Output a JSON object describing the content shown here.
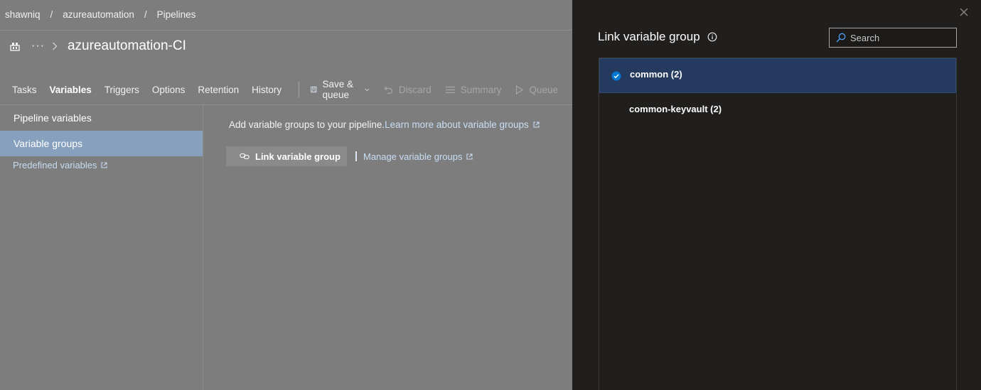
{
  "breadcrumb": [
    "shawniq",
    "azureautomation",
    "Pipelines"
  ],
  "breadcrumb_separator": "/",
  "pipeline": {
    "more_label": "···",
    "title": "azureautomation-CI"
  },
  "tabs": [
    {
      "label": "Tasks",
      "active": false
    },
    {
      "label": "Variables",
      "active": true
    },
    {
      "label": "Triggers",
      "active": false
    },
    {
      "label": "Options",
      "active": false
    },
    {
      "label": "Retention",
      "active": false
    },
    {
      "label": "History",
      "active": false
    }
  ],
  "toolbar": {
    "save_queue": "Save & queue",
    "discard": "Discard",
    "summary": "Summary",
    "queue": "Queue"
  },
  "side_nav": {
    "pipeline_variables": "Pipeline variables",
    "variable_groups": "Variable groups",
    "predefined_variables": "Predefined variables"
  },
  "content": {
    "intro": "Add variable groups to your pipeline.",
    "learn_more": "Learn more about variable groups",
    "link_button": "Link variable group",
    "manage_link": "Manage variable groups"
  },
  "panel": {
    "title": "Link variable group",
    "search_placeholder": "Search",
    "groups": [
      {
        "label": "common (2)",
        "selected": true
      },
      {
        "label": "common-keyvault (2)",
        "selected": false
      }
    ]
  },
  "colors": {
    "overlay_bg": "#7d7d7d",
    "panel_bg": "#201f1e",
    "selected_row": "#243a5e",
    "accent": "#0078d4",
    "link": "#c9def5"
  }
}
